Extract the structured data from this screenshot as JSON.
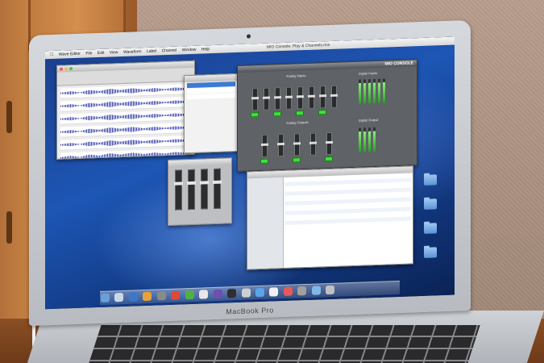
{
  "laptop": {
    "brand_label": "MacBook Pro"
  },
  "menubar": {
    "items": [
      "Wave Editor",
      "File",
      "Edit",
      "View",
      "Waveform",
      "Label",
      "Channel",
      "Window",
      "Help"
    ],
    "window_title": "MIO Console: Play & Channels.mio"
  },
  "console": {
    "logo": "MIO CONSOLE",
    "sections": [
      "Analog Inputs",
      "Digital Inputs",
      "Analog Outputs",
      "Digital Output"
    ]
  },
  "colors": {
    "wallpaper": "#1d56b5",
    "console_bg": "#5f6266",
    "button_green": "#3ee03a",
    "door": "#c98545",
    "wall": "#b89d8c"
  }
}
